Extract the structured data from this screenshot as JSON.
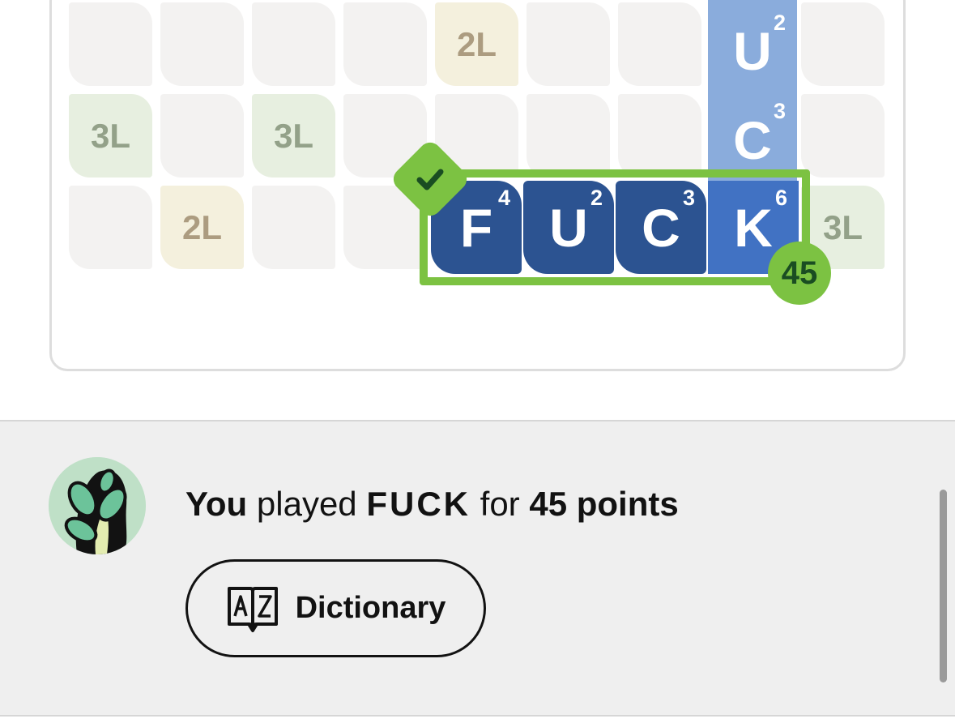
{
  "board": {
    "premium_labels": {
      "double_letter": "2L",
      "triple_letter": "3L"
    },
    "placed_word_tiles": [
      {
        "letter": "F",
        "points": "4"
      },
      {
        "letter": "U",
        "points": "2"
      },
      {
        "letter": "C",
        "points": "3"
      },
      {
        "letter": "K",
        "points": "6"
      }
    ],
    "existing_tiles": [
      {
        "letter": "U",
        "points": "2"
      },
      {
        "letter": "C",
        "points": "3"
      }
    ],
    "word_score": "45",
    "colors": {
      "tile": "#2c5391",
      "highlight": "#7cc242",
      "existing": "#8aacdc"
    }
  },
  "result": {
    "prefix": "You",
    "middle": "played",
    "word": "FUCK",
    "for_text": "for",
    "points_text": "45 points"
  },
  "dictionary_button": {
    "label": "Dictionary",
    "icon": "a-z-book-icon"
  }
}
